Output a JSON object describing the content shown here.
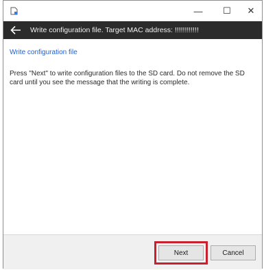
{
  "window": {
    "minimize_glyph": "—",
    "maximize_glyph": "☐",
    "close_glyph": "✕"
  },
  "header": {
    "title": "Write configuration file. Target MAC address: !!!!!!!!!!!!"
  },
  "content": {
    "section_title": "Write configuration file",
    "message": "Press \"Next\" to write configuration files to the SD card. Do not remove the SD card until you see the message that the writing is complete."
  },
  "footer": {
    "next_label": "Next",
    "cancel_label": "Cancel"
  },
  "colors": {
    "header_bg": "#2b2b2b",
    "link_blue": "#1f5fd1",
    "highlight_red": "#c8202f"
  },
  "icons": {
    "app": "app-icon",
    "back": "back-arrow-icon"
  }
}
